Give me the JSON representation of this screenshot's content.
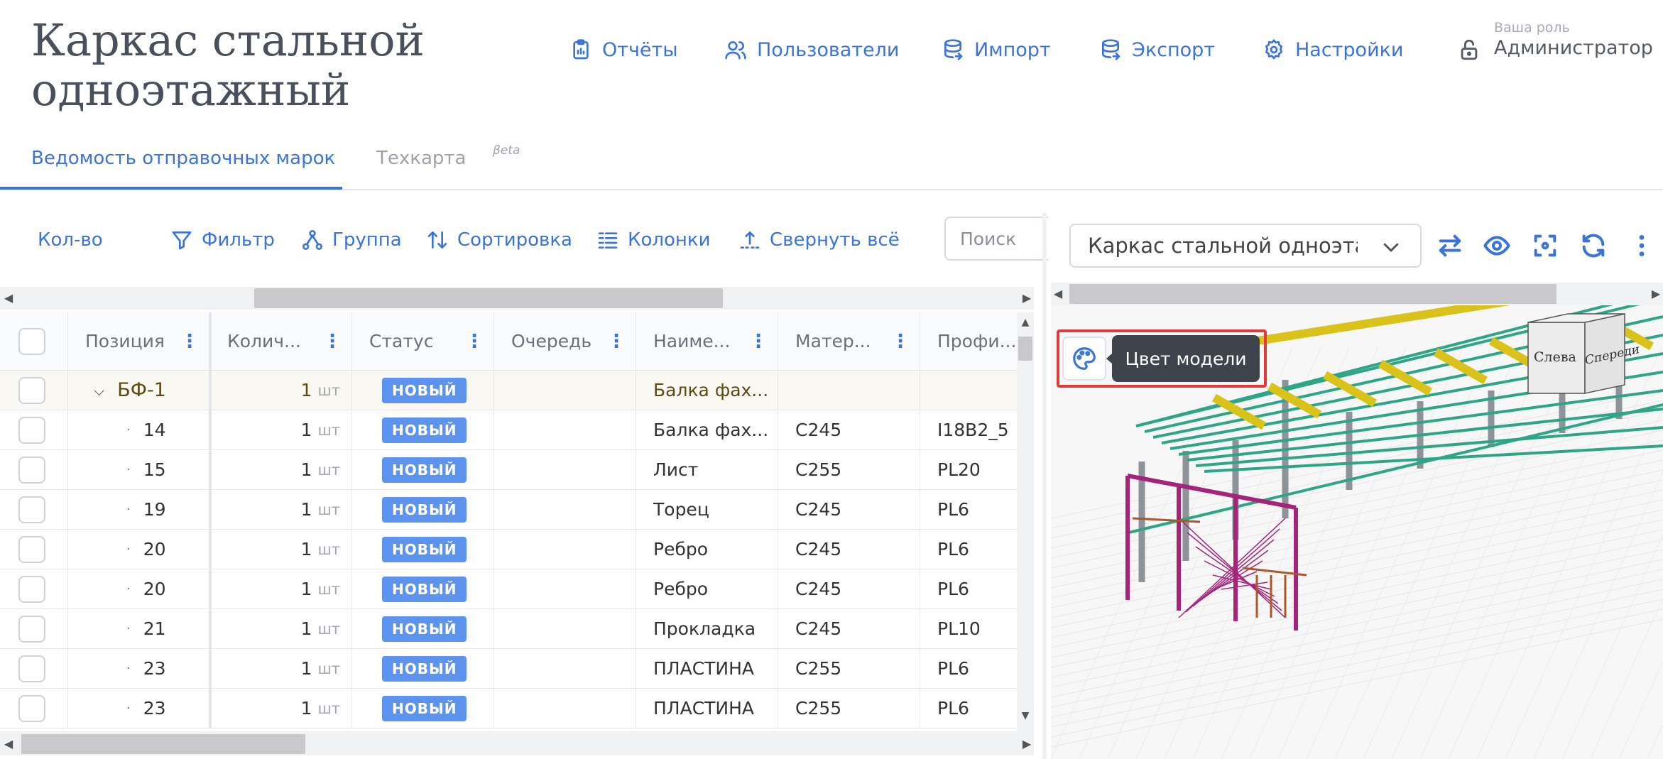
{
  "header": {
    "title": "Каркас стальной одноэтажный",
    "nav": [
      {
        "label": "Отчёты",
        "icon": "clipboard-icon"
      },
      {
        "label": "Пользователи",
        "icon": "users-icon"
      },
      {
        "label": "Импорт",
        "icon": "database-import-icon"
      },
      {
        "label": "Экспорт",
        "icon": "database-export-icon"
      },
      {
        "label": "Настройки",
        "icon": "gear-icon"
      }
    ],
    "role_caption": "Ваша роль",
    "role_value": "Администратор"
  },
  "tabs": {
    "active": "Ведомость отправочных марок",
    "second": "Техкарта",
    "beta": "βeta"
  },
  "toolbar": {
    "qty": "Кол-во",
    "filter": "Фильтр",
    "group": "Группа",
    "sort": "Сортировка",
    "columns": "Колонки",
    "collapse": "Свернуть всё",
    "search_placeholder": "Поиск"
  },
  "table": {
    "columns": [
      "Позиция",
      "Колич...",
      "Статус",
      "Очередь",
      "Наиме...",
      "Матер...",
      "Профи..."
    ],
    "unit": "шт",
    "rows": [
      {
        "pos": "БФ-1",
        "qty": "1",
        "status": "НОВЫЙ",
        "queue": "",
        "name": "Балка фах...",
        "material": "",
        "profile": "",
        "group": true
      },
      {
        "pos": "14",
        "qty": "1",
        "status": "НОВЫЙ",
        "queue": "",
        "name": "Балка фах...",
        "material": "C245",
        "profile": "I18B2_5"
      },
      {
        "pos": "15",
        "qty": "1",
        "status": "НОВЫЙ",
        "queue": "",
        "name": "Лист",
        "material": "C255",
        "profile": "PL20"
      },
      {
        "pos": "19",
        "qty": "1",
        "status": "НОВЫЙ",
        "queue": "",
        "name": "Торец",
        "material": "C245",
        "profile": "PL6"
      },
      {
        "pos": "20",
        "qty": "1",
        "status": "НОВЫЙ",
        "queue": "",
        "name": "Ребро",
        "material": "C245",
        "profile": "PL6"
      },
      {
        "pos": "20",
        "qty": "1",
        "status": "НОВЫЙ",
        "queue": "",
        "name": "Ребро",
        "material": "C245",
        "profile": "PL6"
      },
      {
        "pos": "21",
        "qty": "1",
        "status": "НОВЫЙ",
        "queue": "",
        "name": "Прокладка",
        "material": "C245",
        "profile": "PL10"
      },
      {
        "pos": "23",
        "qty": "1",
        "status": "НОВЫЙ",
        "queue": "",
        "name": "ПЛАСТИНА",
        "material": "C255",
        "profile": "PL6"
      },
      {
        "pos": "23",
        "qty": "1",
        "status": "НОВЫЙ",
        "queue": "",
        "name": "ПЛАСТИНА",
        "material": "C255",
        "profile": "PL6"
      }
    ]
  },
  "viewer": {
    "model_select": "Каркас стальной одноэтажный",
    "tooltip": "Цвет модели",
    "cube_left": "Слева",
    "cube_front": "Спереди",
    "colors": {
      "accent": "#3a74d9",
      "highlight": "#e03a3a",
      "beam_yellow": "#d9c21a",
      "purlin_green": "#2ea587",
      "frame_magenta": "#a3247a",
      "column_gray": "#8e939a",
      "brace_brown": "#a8582a"
    }
  }
}
